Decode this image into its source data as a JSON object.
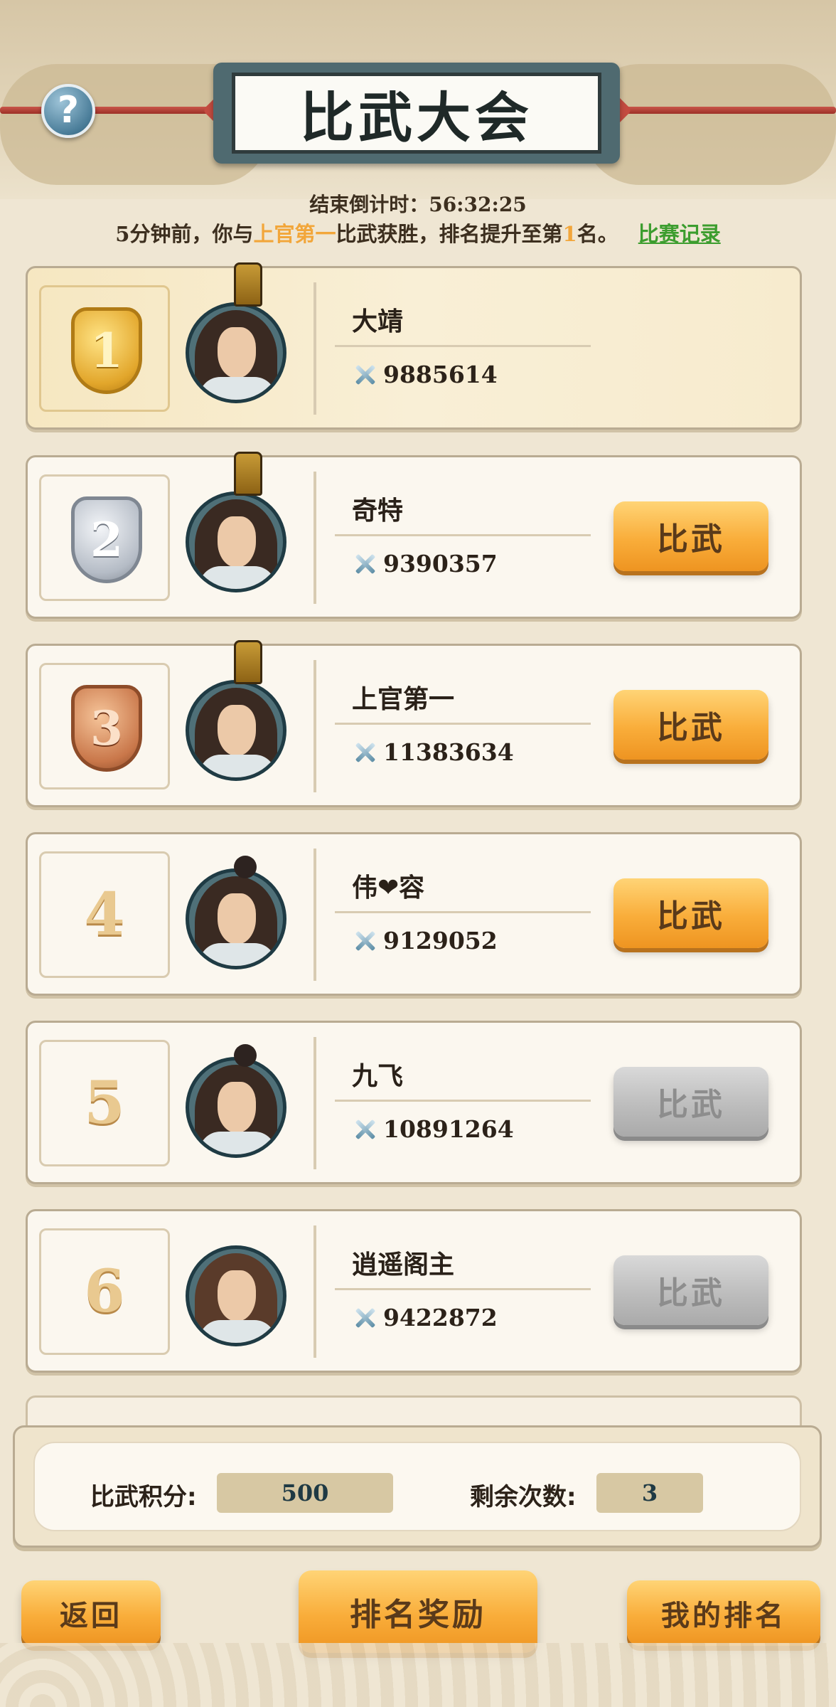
{
  "header": {
    "title": "比武大会",
    "help_label": "?",
    "countdown_label": "结束倒计时：",
    "countdown_value": "56:32:25"
  },
  "news": {
    "prefix": "5分钟前，你与",
    "opponent": "上官第一",
    "middle": "比武获胜，排名提升至第",
    "rank": "1",
    "suffix": "名。",
    "record_link": "比赛记录"
  },
  "ranking": [
    {
      "rank": "1",
      "name": "大靖",
      "power": "9885614",
      "button": ""
    },
    {
      "rank": "2",
      "name": "奇特",
      "power": "9390357",
      "button": "比武"
    },
    {
      "rank": "3",
      "name": "上官第一",
      "power": "11383634",
      "button": "比武"
    },
    {
      "rank": "4",
      "name": "伟❤容",
      "power": "9129052",
      "button": "比武"
    },
    {
      "rank": "5",
      "name": "九飞",
      "power": "10891264",
      "button": "比武"
    },
    {
      "rank": "6",
      "name": "逍遥阁主",
      "power": "9422872",
      "button": "比武"
    }
  ],
  "stats": {
    "points_label": "比武积分:",
    "points_value": "500",
    "remaining_label": "剩余次数:",
    "remaining_value": "3"
  },
  "bottom": {
    "back": "返回",
    "rank_reward": "排名奖励",
    "my_rank": "我的排名"
  },
  "colors": {
    "highlight": "#f2a63a",
    "link": "#3c9d2e",
    "button_orange": "#f9ad3a",
    "button_disabled": "#bdbdbd"
  }
}
